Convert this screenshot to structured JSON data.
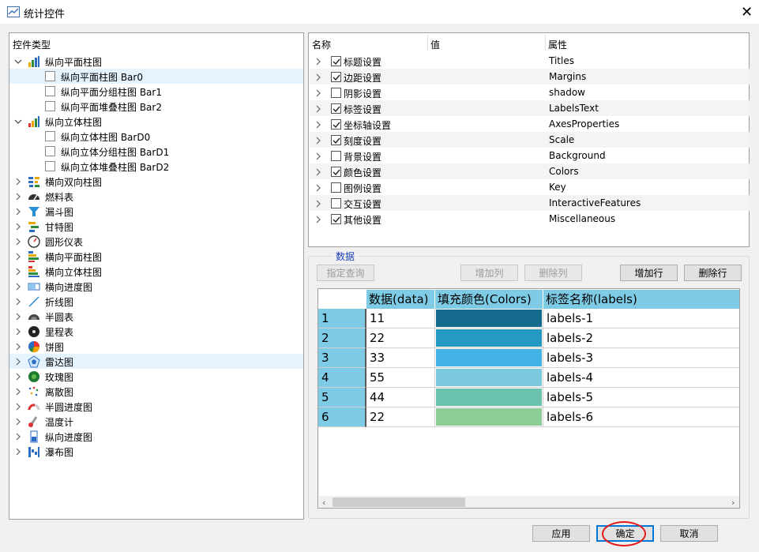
{
  "window": {
    "title": "统计控件",
    "close_glyph": "✕"
  },
  "tree": {
    "header": "控件类型",
    "items": [
      {
        "label": "纵向平面柱图",
        "level": 0,
        "expanded": true,
        "icon": "bar-chart-icon",
        "selected": false
      },
      {
        "label": "纵向平面柱图 Bar0",
        "level": 1,
        "selected": true
      },
      {
        "label": "纵向平面分组柱图 Bar1",
        "level": 1,
        "selected": false
      },
      {
        "label": "纵向平面堆叠柱图 Bar2",
        "level": 1,
        "selected": false
      },
      {
        "label": "纵向立体柱图",
        "level": 0,
        "expanded": true,
        "icon": "bar3d-chart-icon",
        "selected": false
      },
      {
        "label": "纵向立体柱图 BarD0",
        "level": 1,
        "selected": false
      },
      {
        "label": "纵向立体分组柱图 BarD1",
        "level": 1,
        "selected": false
      },
      {
        "label": "纵向立体堆叠柱图 BarD2",
        "level": 1,
        "selected": false
      },
      {
        "label": "横向双向柱图",
        "level": 0,
        "expanded": false,
        "icon": "bidirectional-bar-icon",
        "selected": false
      },
      {
        "label": "燃料表",
        "level": 0,
        "expanded": false,
        "icon": "fuel-gauge-icon",
        "selected": false
      },
      {
        "label": "漏斗图",
        "level": 0,
        "expanded": false,
        "icon": "funnel-icon",
        "selected": false
      },
      {
        "label": "甘特图",
        "level": 0,
        "expanded": false,
        "icon": "gantt-icon",
        "selected": false
      },
      {
        "label": "圆形仪表",
        "level": 0,
        "expanded": false,
        "icon": "round-gauge-icon",
        "selected": false
      },
      {
        "label": "横向平面柱图",
        "level": 0,
        "expanded": false,
        "icon": "horizontal-bar-icon",
        "selected": false
      },
      {
        "label": "横向立体柱图",
        "level": 0,
        "expanded": false,
        "icon": "horizontal-bar3d-icon",
        "selected": false
      },
      {
        "label": "横向进度图",
        "level": 0,
        "expanded": false,
        "icon": "horizontal-progress-icon",
        "selected": false
      },
      {
        "label": "折线图",
        "level": 0,
        "expanded": false,
        "icon": "line-chart-icon",
        "selected": false
      },
      {
        "label": "半圆表",
        "level": 0,
        "expanded": false,
        "icon": "semicircle-gauge-icon",
        "selected": false
      },
      {
        "label": "里程表",
        "level": 0,
        "expanded": false,
        "icon": "odometer-icon",
        "selected": false
      },
      {
        "label": "饼图",
        "level": 0,
        "expanded": false,
        "icon": "pie-chart-icon",
        "selected": false
      },
      {
        "label": "雷达图",
        "level": 0,
        "expanded": false,
        "icon": "radar-chart-icon",
        "selected": true
      },
      {
        "label": "玫瑰图",
        "level": 0,
        "expanded": false,
        "icon": "rose-chart-icon",
        "selected": false
      },
      {
        "label": "离散图",
        "level": 0,
        "expanded": false,
        "icon": "scatter-icon",
        "selected": false
      },
      {
        "label": "半圆进度图",
        "level": 0,
        "expanded": false,
        "icon": "semicircle-progress-icon",
        "selected": false
      },
      {
        "label": "温度计",
        "level": 0,
        "expanded": false,
        "icon": "thermometer-icon",
        "selected": false
      },
      {
        "label": "纵向进度图",
        "level": 0,
        "expanded": false,
        "icon": "vertical-progress-icon",
        "selected": false
      },
      {
        "label": "瀑布图",
        "level": 0,
        "expanded": false,
        "icon": "waterfall-icon",
        "selected": false
      }
    ]
  },
  "properties": {
    "headers": {
      "name": "名称",
      "value": "值",
      "attr": "属性"
    },
    "rows": [
      {
        "name": "标题设置",
        "attr": "Titles",
        "checked": true
      },
      {
        "name": "边距设置",
        "attr": "Margins",
        "checked": true
      },
      {
        "name": "阴影设置",
        "attr": "shadow",
        "checked": false
      },
      {
        "name": "标签设置",
        "attr": "LabelsText",
        "checked": true
      },
      {
        "name": "坐标轴设置",
        "attr": "AxesProperties",
        "checked": true
      },
      {
        "name": "刻度设置",
        "attr": "Scale",
        "checked": true
      },
      {
        "name": "背景设置",
        "attr": "Background",
        "checked": false
      },
      {
        "name": "颜色设置",
        "attr": "Colors",
        "checked": true
      },
      {
        "name": "图例设置",
        "attr": "Key",
        "checked": false
      },
      {
        "name": "交互设置",
        "attr": "InteractiveFeatures",
        "checked": false
      },
      {
        "name": "其他设置",
        "attr": "Miscellaneous",
        "checked": true
      }
    ]
  },
  "data_group": {
    "title": "数据",
    "buttons": {
      "query": "指定查询",
      "add_col": "增加列",
      "del_col": "删除列",
      "add_row": "增加行",
      "del_row": "删除行"
    },
    "columns": [
      "数据(data)",
      "填充颜色(Colors)",
      "标签名称(labels)"
    ],
    "rows": [
      {
        "num": "1",
        "data": "11",
        "color": "#156b8e",
        "label": "labels-1"
      },
      {
        "num": "2",
        "data": "22",
        "color": "#2598c3",
        "label": "labels-2"
      },
      {
        "num": "3",
        "data": "33",
        "color": "#44b2e4",
        "label": "labels-3"
      },
      {
        "num": "4",
        "data": "55",
        "color": "#7ac9dc",
        "label": "labels-4"
      },
      {
        "num": "5",
        "data": "44",
        "color": "#6cc3ad",
        "label": "labels-5"
      },
      {
        "num": "6",
        "data": "22",
        "color": "#8ccd95",
        "label": "labels-6"
      }
    ],
    "scroll_left": "‹",
    "scroll_right": "›"
  },
  "footer": {
    "apply": "应用",
    "ok": "确定",
    "cancel": "取消"
  },
  "colors": {
    "grid_header": "#7ecbe6",
    "selection": "#e5f3ff",
    "annotation": "#e31b1b",
    "accent": "#0078d7"
  }
}
